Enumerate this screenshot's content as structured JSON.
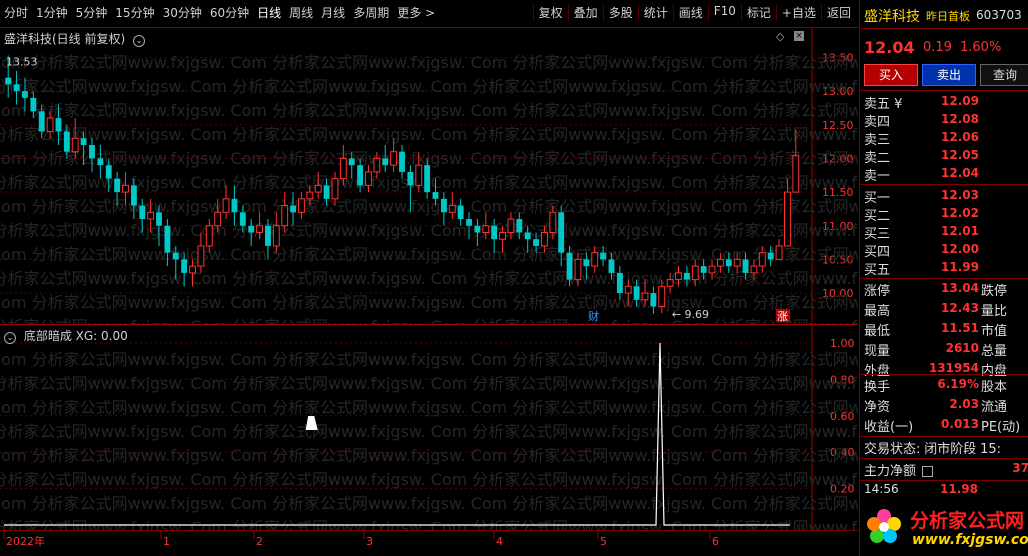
{
  "toolbar": {
    "periods": [
      "分时",
      "1分钟",
      "5分钟",
      "15分钟",
      "30分钟",
      "60分钟",
      "日线",
      "周线",
      "月线",
      "多周期",
      "更多 >"
    ],
    "tools": [
      "复权",
      "叠加",
      "多股",
      "统计",
      "画线",
      "F10",
      "标记",
      "+自选",
      "返回"
    ]
  },
  "main": {
    "title": "盛洋科技(日线 前复权)",
    "high_label": "13.53",
    "low_label": "9.69",
    "tag_cai": "财",
    "tag_zhang": "涨",
    "y_ticks": [
      "13.50",
      "13.00",
      "12.50",
      "12.00",
      "11.50",
      "11.00",
      "10.50",
      "10.00"
    ]
  },
  "sub": {
    "title": "底部暗成  XG: 0.00",
    "y_ticks": [
      "1.00",
      "0.80",
      "0.60",
      "0.40",
      "0.20"
    ]
  },
  "date_axis": {
    "labels": [
      "2022年",
      "1",
      "2",
      "3",
      "4",
      "5",
      "6"
    ]
  },
  "watermark": "Com 分析家公式网www.fxjgsw.",
  "panel": {
    "name": "盛洋科技",
    "tag": "昨日首板",
    "code": "603703",
    "price": "12.04",
    "change": "0.19",
    "pct": "1.60%",
    "buy": "买入",
    "sell": "卖出",
    "query": "查询",
    "asks": [
      {
        "label": "卖五 ¥",
        "value": "12.09"
      },
      {
        "label": "卖四",
        "value": "12.08"
      },
      {
        "label": "卖三",
        "value": "12.06"
      },
      {
        "label": "卖二",
        "value": "12.05"
      },
      {
        "label": "卖一",
        "value": "12.04"
      }
    ],
    "bids": [
      {
        "label": "买一",
        "value": "12.03"
      },
      {
        "label": "买二",
        "value": "12.02"
      },
      {
        "label": "买三",
        "value": "12.01"
      },
      {
        "label": "买四",
        "value": "12.00"
      },
      {
        "label": "买五",
        "value": "11.99"
      }
    ],
    "stats1": [
      {
        "label": "涨停",
        "value": "13.04",
        "color": "red",
        "label2": "跌停"
      },
      {
        "label": "最高",
        "value": "12.43",
        "color": "red",
        "label2": "量比"
      },
      {
        "label": "最低",
        "value": "11.51",
        "color": "green",
        "label2": "市值"
      },
      {
        "label": "现量",
        "value": "2610",
        "color": "purple",
        "label2": "总量"
      },
      {
        "label": "外盘",
        "value": "131954",
        "color": "red",
        "label2": "内盘"
      }
    ],
    "stats2": [
      {
        "label": "换手",
        "value": "6.19%",
        "color": "white",
        "label2": "股本"
      },
      {
        "label": "净资",
        "value": "2.03",
        "color": "white",
        "label2": "流通"
      },
      {
        "label": "收益(一)",
        "value": "0.013",
        "color": "white",
        "label2": "PE(动)"
      }
    ],
    "trade_state_label": "交易状态:",
    "trade_state_value": "闭市阶段",
    "trade_state_extra": "15:",
    "main_flow_label": "主力净额",
    "main_flow_value": "37",
    "tick_time": "14:56",
    "tick_price": "11.98",
    "logo_text": "分析家公式网",
    "logo_url": "www.fxjgsw.com"
  },
  "colors": {
    "up": "#ff3232",
    "down": "#00c8c8",
    "grid": "#7a0000",
    "bg": "#000000"
  },
  "chart_data": {
    "type": "candlestick",
    "ylim": [
      9.6,
      13.7
    ],
    "candles": [
      [
        13.2,
        13.1,
        13.53,
        12.9
      ],
      [
        13.1,
        13.0,
        13.3,
        12.8
      ],
      [
        13.0,
        12.9,
        13.2,
        12.7
      ],
      [
        12.9,
        12.7,
        13.0,
        12.6
      ],
      [
        12.7,
        12.4,
        12.8,
        12.3
      ],
      [
        12.4,
        12.6,
        12.7,
        12.3
      ],
      [
        12.6,
        12.4,
        12.8,
        12.2
      ],
      [
        12.4,
        12.1,
        12.5,
        12.0
      ],
      [
        12.1,
        12.3,
        12.6,
        12.0
      ],
      [
        12.3,
        12.2,
        12.4,
        11.9
      ],
      [
        12.2,
        12.0,
        12.3,
        11.8
      ],
      [
        12.0,
        11.9,
        12.2,
        11.7
      ],
      [
        11.9,
        11.7,
        12.0,
        11.5
      ],
      [
        11.7,
        11.5,
        11.8,
        11.3
      ],
      [
        11.5,
        11.6,
        11.8,
        11.3
      ],
      [
        11.6,
        11.3,
        11.7,
        11.1
      ],
      [
        11.3,
        11.1,
        11.4,
        10.9
      ],
      [
        11.1,
        11.2,
        11.4,
        10.9
      ],
      [
        11.2,
        11.0,
        11.3,
        10.7
      ],
      [
        11.0,
        10.6,
        11.1,
        10.4
      ],
      [
        10.6,
        10.5,
        10.7,
        10.2
      ],
      [
        10.5,
        10.3,
        10.6,
        10.1
      ],
      [
        10.3,
        10.4,
        10.5,
        10.1
      ],
      [
        10.4,
        10.7,
        10.9,
        10.3
      ],
      [
        10.7,
        11.0,
        11.1,
        10.6
      ],
      [
        11.0,
        11.2,
        11.4,
        10.9
      ],
      [
        11.2,
        11.4,
        11.6,
        11.1
      ],
      [
        11.4,
        11.2,
        11.6,
        11.0
      ],
      [
        11.2,
        11.0,
        11.3,
        10.9
      ],
      [
        11.0,
        10.9,
        11.1,
        10.7
      ],
      [
        10.9,
        11.0,
        11.2,
        10.8
      ],
      [
        11.0,
        10.7,
        11.1,
        10.5
      ],
      [
        10.7,
        11.0,
        11.2,
        10.6
      ],
      [
        11.0,
        11.3,
        11.5,
        10.9
      ],
      [
        11.3,
        11.2,
        11.5,
        11.0
      ],
      [
        11.2,
        11.4,
        11.5,
        11.1
      ],
      [
        11.4,
        11.5,
        11.6,
        11.3
      ],
      [
        11.5,
        11.6,
        11.8,
        11.4
      ],
      [
        11.6,
        11.4,
        11.7,
        11.3
      ],
      [
        11.4,
        11.7,
        11.8,
        11.3
      ],
      [
        11.7,
        12.0,
        12.2,
        11.6
      ],
      [
        12.0,
        11.9,
        12.1,
        11.7
      ],
      [
        11.9,
        11.6,
        12.0,
        11.5
      ],
      [
        11.6,
        11.8,
        11.9,
        11.5
      ],
      [
        11.8,
        12.0,
        12.1,
        11.7
      ],
      [
        12.0,
        11.9,
        12.2,
        11.8
      ],
      [
        11.9,
        12.1,
        12.3,
        11.8
      ],
      [
        12.1,
        11.8,
        12.2,
        11.7
      ],
      [
        11.8,
        11.6,
        11.9,
        11.2
      ],
      [
        11.6,
        11.9,
        12.1,
        11.5
      ],
      [
        11.9,
        11.5,
        12.0,
        11.4
      ],
      [
        11.5,
        11.4,
        11.7,
        11.3
      ],
      [
        11.4,
        11.2,
        11.5,
        11.0
      ],
      [
        11.2,
        11.3,
        11.5,
        11.1
      ],
      [
        11.3,
        11.1,
        11.4,
        11.0
      ],
      [
        11.1,
        11.0,
        11.2,
        10.8
      ],
      [
        11.0,
        10.9,
        11.1,
        10.7
      ],
      [
        10.9,
        11.0,
        11.2,
        10.8
      ],
      [
        11.0,
        10.8,
        11.1,
        10.6
      ],
      [
        10.8,
        10.9,
        11.0,
        10.6
      ],
      [
        10.9,
        11.1,
        11.2,
        10.8
      ],
      [
        11.1,
        10.9,
        11.2,
        10.8
      ],
      [
        10.9,
        10.8,
        11.0,
        10.6
      ],
      [
        10.8,
        10.7,
        10.9,
        10.6
      ],
      [
        10.7,
        10.9,
        11.0,
        10.6
      ],
      [
        10.9,
        11.2,
        11.3,
        10.8
      ],
      [
        11.2,
        10.6,
        11.3,
        10.4
      ],
      [
        10.6,
        10.2,
        10.7,
        10.1
      ],
      [
        10.2,
        10.5,
        10.6,
        10.1
      ],
      [
        10.5,
        10.4,
        10.6,
        10.2
      ],
      [
        10.4,
        10.6,
        10.7,
        10.3
      ],
      [
        10.6,
        10.5,
        10.7,
        10.4
      ],
      [
        10.5,
        10.3,
        10.6,
        10.2
      ],
      [
        10.3,
        10.0,
        10.4,
        9.9
      ],
      [
        10.0,
        10.1,
        10.2,
        9.8
      ],
      [
        10.1,
        9.9,
        10.2,
        9.8
      ],
      [
        9.9,
        10.0,
        10.2,
        9.8
      ],
      [
        10.0,
        9.8,
        10.1,
        9.69
      ],
      [
        9.8,
        10.1,
        10.2,
        9.7
      ],
      [
        10.1,
        10.2,
        10.3,
        10.0
      ],
      [
        10.2,
        10.3,
        10.4,
        10.1
      ],
      [
        10.3,
        10.2,
        10.4,
        10.1
      ],
      [
        10.2,
        10.4,
        10.5,
        10.1
      ],
      [
        10.4,
        10.3,
        10.5,
        10.2
      ],
      [
        10.3,
        10.4,
        10.5,
        10.2
      ],
      [
        10.4,
        10.5,
        10.6,
        10.3
      ],
      [
        10.5,
        10.4,
        10.6,
        10.3
      ],
      [
        10.4,
        10.5,
        10.6,
        10.3
      ],
      [
        10.5,
        10.3,
        10.6,
        10.2
      ],
      [
        10.3,
        10.4,
        10.5,
        10.2
      ],
      [
        10.4,
        10.6,
        10.7,
        10.3
      ],
      [
        10.6,
        10.5,
        10.7,
        10.4
      ],
      [
        10.5,
        10.7,
        10.8,
        10.5
      ],
      [
        10.7,
        11.5,
        11.7,
        10.7
      ],
      [
        11.5,
        12.04,
        12.43,
        11.51
      ]
    ],
    "signal_x_index": 78,
    "signal_value": 1.0
  }
}
